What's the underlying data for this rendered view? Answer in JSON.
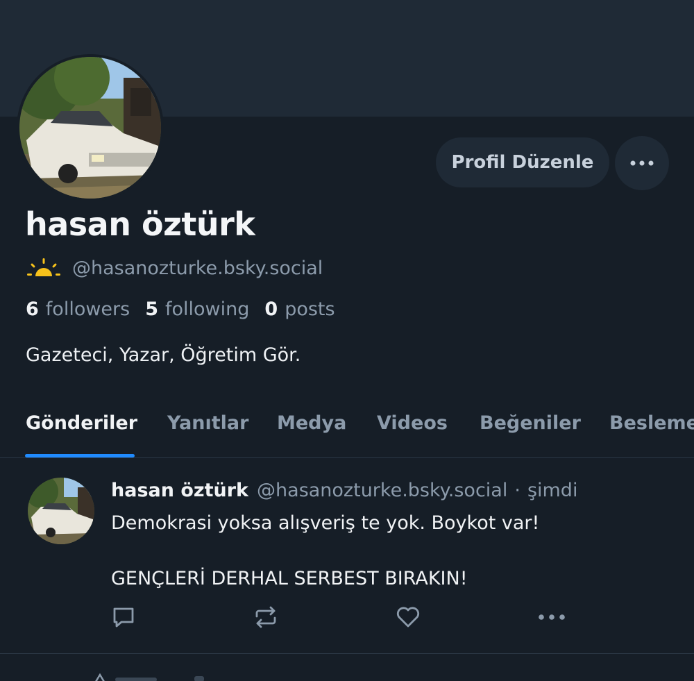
{
  "profile": {
    "display_name": "hasan öztürk",
    "handle": "@hasanozturke.bsky.social",
    "status_icon": "sunrise-icon",
    "bio": "Gazeteci, Yazar, Öğretim Gör."
  },
  "actions": {
    "edit_label": "Profil Düzenle",
    "more_icon": "ellipsis-icon"
  },
  "stats": {
    "followers_count": "6",
    "followers_label": "followers",
    "following_count": "5",
    "following_label": "following",
    "posts_count": "0",
    "posts_label": "posts"
  },
  "tabs": [
    {
      "label": "Gönderiler",
      "active": true
    },
    {
      "label": "Yanıtlar"
    },
    {
      "label": "Medya"
    },
    {
      "label": "Videos"
    },
    {
      "label": "Beğeniler"
    },
    {
      "label": "Beslemeler"
    }
  ],
  "post": {
    "author": "hasan öztürk",
    "handle": "@hasanozturke.bsky.social",
    "separator": "·",
    "time": "şimdi",
    "text": "Demokrasi yoksa alışveriş te yok. Boykot var!\n\nGENÇLERİ DERHAL SERBEST BIRAKIN!",
    "action_icons": [
      "reply-icon",
      "repost-icon",
      "like-icon",
      "post-more-icon"
    ]
  },
  "colors": {
    "background": "#161e27",
    "banner": "#1f2a36",
    "accent": "#208bfe",
    "muted_text": "#8c9bab",
    "sun": "#f7c21b"
  }
}
